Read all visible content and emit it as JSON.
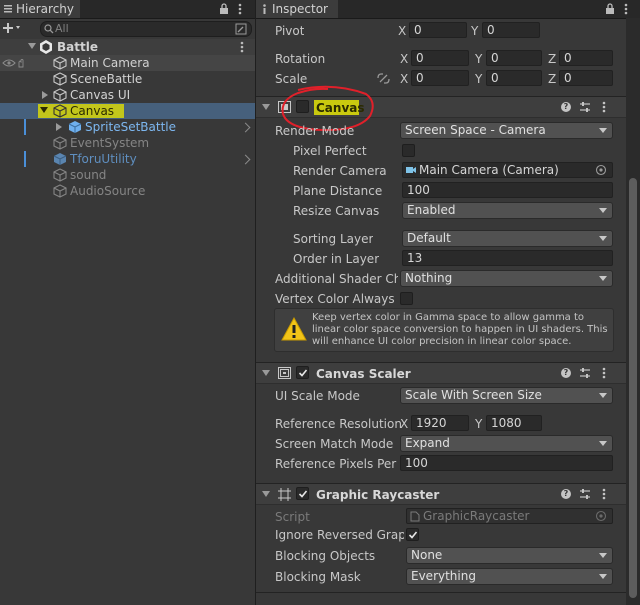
{
  "hierarchy": {
    "tab_label": "Hierarchy",
    "search_placeholder": "All",
    "scene": "Battle",
    "items": [
      {
        "label": "Main Camera"
      },
      {
        "label": "SceneBattle"
      },
      {
        "label": "Canvas UI"
      },
      {
        "label": "Canvas"
      },
      {
        "label": "SpriteSetBattle"
      },
      {
        "label": "EventSystem"
      },
      {
        "label": "TforuUtility"
      },
      {
        "label": "sound"
      },
      {
        "label": "AudioSource"
      }
    ]
  },
  "inspector": {
    "tab_label": "Inspector",
    "rect": {
      "pivot_label": "Pivot",
      "pivot_x": "0",
      "pivot_y": "0",
      "rotation_label": "Rotation",
      "rot_x": "0",
      "rot_y": "0",
      "rot_z": "0",
      "scale_label": "Scale",
      "scale_x": "0",
      "scale_y": "0",
      "scale_z": "0",
      "axis_x": "X",
      "axis_y": "Y",
      "axis_z": "Z"
    },
    "canvas": {
      "title": "Canvas",
      "render_mode_label": "Render Mode",
      "render_mode": "Screen Space - Camera",
      "pixel_perfect_label": "Pixel Perfect",
      "render_camera_label": "Render Camera",
      "render_camera": "Main Camera (Camera)",
      "plane_distance_label": "Plane Distance",
      "plane_distance": "100",
      "resize_canvas_label": "Resize Canvas",
      "resize_canvas": "Enabled",
      "sorting_layer_label": "Sorting Layer",
      "sorting_layer": "Default",
      "order_in_layer_label": "Order in Layer",
      "order_in_layer": "13",
      "shader_channels_label": "Additional Shader Cha",
      "shader_channels": "Nothing",
      "vertex_color_label": "Vertex Color Always In",
      "warning": "Keep vertex color in Gamma space to allow gamma to linear color space conversion to happen in UI shaders. This will enhance UI color precision in linear color space."
    },
    "scaler": {
      "title": "Canvas Scaler",
      "ui_scale_label": "UI Scale Mode",
      "ui_scale": "Scale With Screen Size",
      "ref_res_label": "Reference Resolution",
      "ref_x": "1920",
      "ref_y": "1080",
      "match_label": "Screen Match Mode",
      "match": "Expand",
      "ppu_label": "Reference Pixels Per U",
      "ppu": "100"
    },
    "raycaster": {
      "title": "Graphic Raycaster",
      "script_label": "Script",
      "script": "GraphicRaycaster",
      "ignore_label": "Ignore Reversed Graph",
      "blocking_objects_label": "Blocking Objects",
      "blocking_objects": "None",
      "blocking_mask_label": "Blocking Mask",
      "blocking_mask": "Everything"
    }
  },
  "colors": {
    "selection": "#46607c",
    "highlight": "#f0f020",
    "annotation": "#e0202a",
    "prefab_blue": "#7db7f0"
  }
}
